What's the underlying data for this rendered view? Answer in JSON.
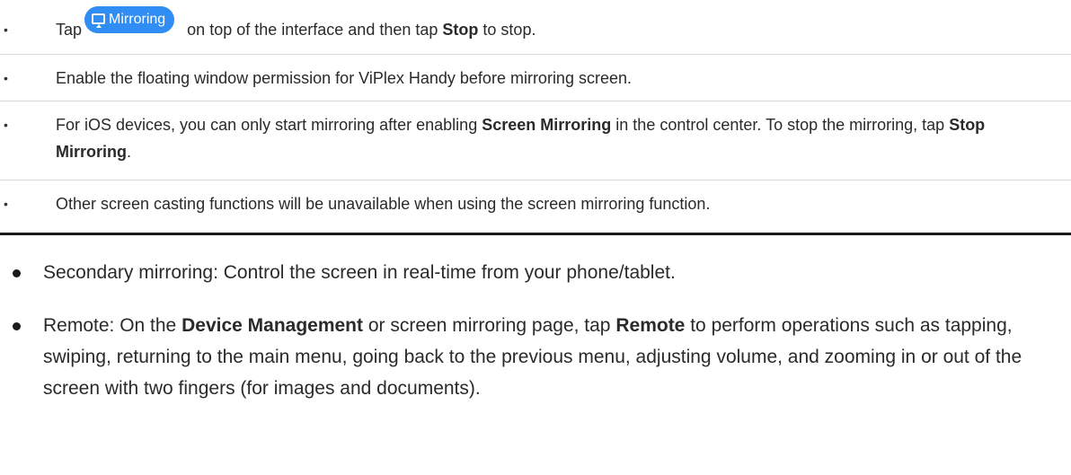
{
  "notes": [
    {
      "tap": "Tap",
      "button_label": "Mirroring",
      "rest": "on top of the interface and then tap",
      "bold": "Stop",
      "end": "to stop."
    },
    {
      "text": "Enable the floating window permission for ViPlex Handy before mirroring screen."
    },
    {
      "part1": "For iOS devices, you can only start mirroring after enabling",
      "bold1": "Screen Mirroring",
      "part2": "in the control center. To stop the mirroring, tap",
      "bold2": "Stop Mirroring",
      "part3": "."
    },
    {
      "text": "Other screen casting functions will be unavailable when using the screen mirroring function."
    }
  ],
  "main": [
    {
      "text": "Secondary mirroring: Control the screen in real-time from your phone/tablet."
    },
    {
      "part1": "Remote: On the",
      "bold1": "Device Management",
      "part2": "or screen mirroring page, tap",
      "bold2": "Remote",
      "part3": "to perform operations such as tapping, swiping, returning to the main menu, going back to the previous menu, adjusting volume, and zooming in or out of the screen with two fingers (for images and documents)."
    }
  ]
}
